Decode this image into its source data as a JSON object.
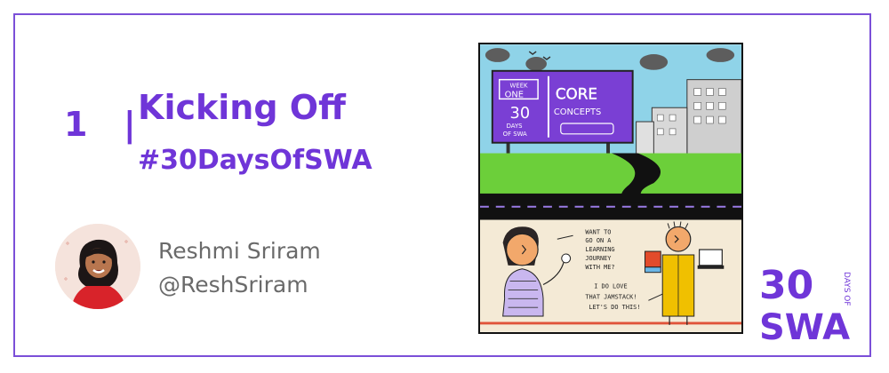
{
  "day": {
    "number": "1",
    "separator": "|"
  },
  "title": "Kicking Off",
  "hashtag": "#30DaysOfSWA",
  "author": {
    "name": "Reshmi Sriram",
    "handle": "@ReshSriram"
  },
  "comic": {
    "billboard_left": {
      "week_label": "WEEK",
      "week_value": "ONE",
      "num": "30",
      "line1": "DAYS",
      "line2": "OF SWA"
    },
    "billboard_right": {
      "line1": "CORE",
      "line2": "CONCEPTS"
    },
    "speech_1": [
      "WANT TO",
      "GO ON A",
      "LEARNING",
      "JOURNEY",
      "WITH ME?"
    ],
    "speech_2": [
      "I DO LOVE",
      "THAT JAMSTACK!",
      "LET'S DO THIS!"
    ]
  },
  "logo": {
    "big": "30",
    "small": "DAYS OF",
    "bottom": "SWA"
  },
  "colors": {
    "accent": "#6f35d8",
    "text_muted": "#6a6a6a",
    "border": "#7b4fd8"
  }
}
